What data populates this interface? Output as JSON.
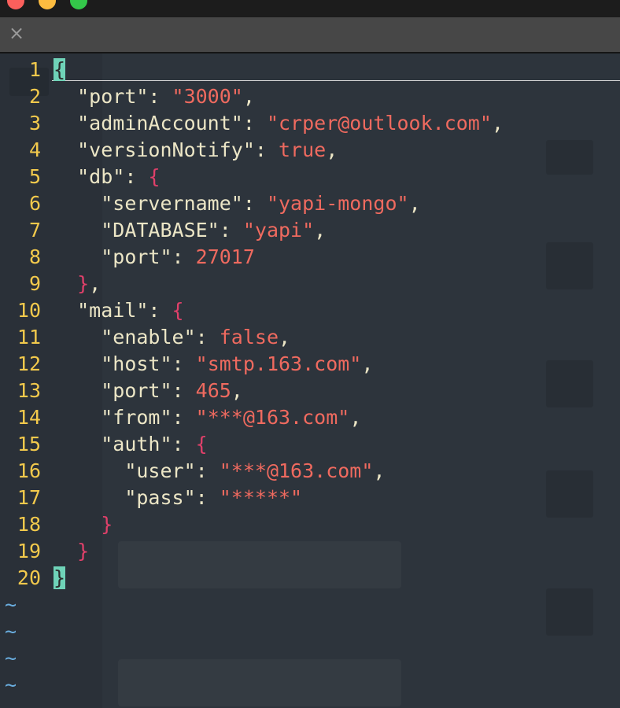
{
  "window": {
    "traffic_lights": [
      "close",
      "minimize",
      "zoom"
    ],
    "colors": {
      "red": "#fc605c",
      "yellow": "#fdbc40",
      "green": "#34c84a"
    }
  },
  "tab": {
    "close_icon": "×"
  },
  "editor": {
    "lines": [
      {
        "num": "1",
        "tokens": [
          {
            "t": "mbrace",
            "v": "{"
          }
        ]
      },
      {
        "num": "2",
        "tokens": [
          {
            "t": "p",
            "v": "  "
          },
          {
            "t": "k",
            "v": "\"port\""
          },
          {
            "t": "p",
            "v": ": "
          },
          {
            "t": "s",
            "v": "\"3000\""
          },
          {
            "t": "p",
            "v": ","
          }
        ]
      },
      {
        "num": "3",
        "tokens": [
          {
            "t": "p",
            "v": "  "
          },
          {
            "t": "k",
            "v": "\"adminAccount\""
          },
          {
            "t": "p",
            "v": ": "
          },
          {
            "t": "s",
            "v": "\"crper@outlook.com\""
          },
          {
            "t": "p",
            "v": ","
          }
        ]
      },
      {
        "num": "4",
        "tokens": [
          {
            "t": "p",
            "v": "  "
          },
          {
            "t": "k",
            "v": "\"versionNotify\""
          },
          {
            "t": "p",
            "v": ": "
          },
          {
            "t": "b",
            "v": "true"
          },
          {
            "t": "p",
            "v": ","
          }
        ]
      },
      {
        "num": "5",
        "tokens": [
          {
            "t": "p",
            "v": "  "
          },
          {
            "t": "k",
            "v": "\"db\""
          },
          {
            "t": "p",
            "v": ": "
          },
          {
            "t": "brace",
            "v": "{"
          }
        ]
      },
      {
        "num": "6",
        "tokens": [
          {
            "t": "p",
            "v": "    "
          },
          {
            "t": "k",
            "v": "\"servername\""
          },
          {
            "t": "p",
            "v": ": "
          },
          {
            "t": "s",
            "v": "\"yapi-mongo\""
          },
          {
            "t": "p",
            "v": ","
          }
        ]
      },
      {
        "num": "7",
        "tokens": [
          {
            "t": "p",
            "v": "    "
          },
          {
            "t": "k",
            "v": "\"DATABASE\""
          },
          {
            "t": "p",
            "v": ": "
          },
          {
            "t": "s",
            "v": "\"yapi\""
          },
          {
            "t": "p",
            "v": ","
          }
        ]
      },
      {
        "num": "8",
        "tokens": [
          {
            "t": "p",
            "v": "    "
          },
          {
            "t": "k",
            "v": "\"port\""
          },
          {
            "t": "p",
            "v": ": "
          },
          {
            "t": "n",
            "v": "27017"
          }
        ]
      },
      {
        "num": "9",
        "tokens": [
          {
            "t": "p",
            "v": "  "
          },
          {
            "t": "brace",
            "v": "}"
          },
          {
            "t": "p",
            "v": ","
          }
        ]
      },
      {
        "num": "10",
        "tokens": [
          {
            "t": "p",
            "v": "  "
          },
          {
            "t": "k",
            "v": "\"mail\""
          },
          {
            "t": "p",
            "v": ": "
          },
          {
            "t": "brace",
            "v": "{"
          }
        ]
      },
      {
        "num": "11",
        "tokens": [
          {
            "t": "p",
            "v": "    "
          },
          {
            "t": "k",
            "v": "\"enable\""
          },
          {
            "t": "p",
            "v": ": "
          },
          {
            "t": "b",
            "v": "false"
          },
          {
            "t": "p",
            "v": ","
          }
        ]
      },
      {
        "num": "12",
        "tokens": [
          {
            "t": "p",
            "v": "    "
          },
          {
            "t": "k",
            "v": "\"host\""
          },
          {
            "t": "p",
            "v": ": "
          },
          {
            "t": "s",
            "v": "\"smtp.163.com\""
          },
          {
            "t": "p",
            "v": ","
          }
        ]
      },
      {
        "num": "13",
        "tokens": [
          {
            "t": "p",
            "v": "    "
          },
          {
            "t": "k",
            "v": "\"port\""
          },
          {
            "t": "p",
            "v": ": "
          },
          {
            "t": "n",
            "v": "465"
          },
          {
            "t": "p",
            "v": ","
          }
        ]
      },
      {
        "num": "14",
        "tokens": [
          {
            "t": "p",
            "v": "    "
          },
          {
            "t": "k",
            "v": "\"from\""
          },
          {
            "t": "p",
            "v": ": "
          },
          {
            "t": "s",
            "v": "\"***@163.com\""
          },
          {
            "t": "p",
            "v": ","
          }
        ]
      },
      {
        "num": "15",
        "tokens": [
          {
            "t": "p",
            "v": "    "
          },
          {
            "t": "k",
            "v": "\"auth\""
          },
          {
            "t": "p",
            "v": ": "
          },
          {
            "t": "brace",
            "v": "{"
          }
        ]
      },
      {
        "num": "16",
        "tokens": [
          {
            "t": "p",
            "v": "      "
          },
          {
            "t": "k",
            "v": "\"user\""
          },
          {
            "t": "p",
            "v": ": "
          },
          {
            "t": "s",
            "v": "\"***@163.com\""
          },
          {
            "t": "p",
            "v": ","
          }
        ]
      },
      {
        "num": "17",
        "tokens": [
          {
            "t": "p",
            "v": "      "
          },
          {
            "t": "k",
            "v": "\"pass\""
          },
          {
            "t": "p",
            "v": ": "
          },
          {
            "t": "s",
            "v": "\"*****\""
          }
        ]
      },
      {
        "num": "18",
        "tokens": [
          {
            "t": "p",
            "v": "    "
          },
          {
            "t": "brace",
            "v": "}"
          }
        ]
      },
      {
        "num": "19",
        "tokens": [
          {
            "t": "p",
            "v": "  "
          },
          {
            "t": "brace",
            "v": "}"
          }
        ]
      },
      {
        "num": "20",
        "tokens": [
          {
            "t": "mbrace",
            "v": "}"
          }
        ]
      }
    ],
    "empty_markers": [
      "~",
      "~",
      "~",
      "~"
    ],
    "colors": {
      "line_number": "#f2c94c",
      "key": "#ece6c6",
      "string": "#ef6a5f",
      "brace": "#e0406a",
      "match_brace_bg": "#6fd3b8",
      "tilde": "#6aaee0"
    }
  }
}
